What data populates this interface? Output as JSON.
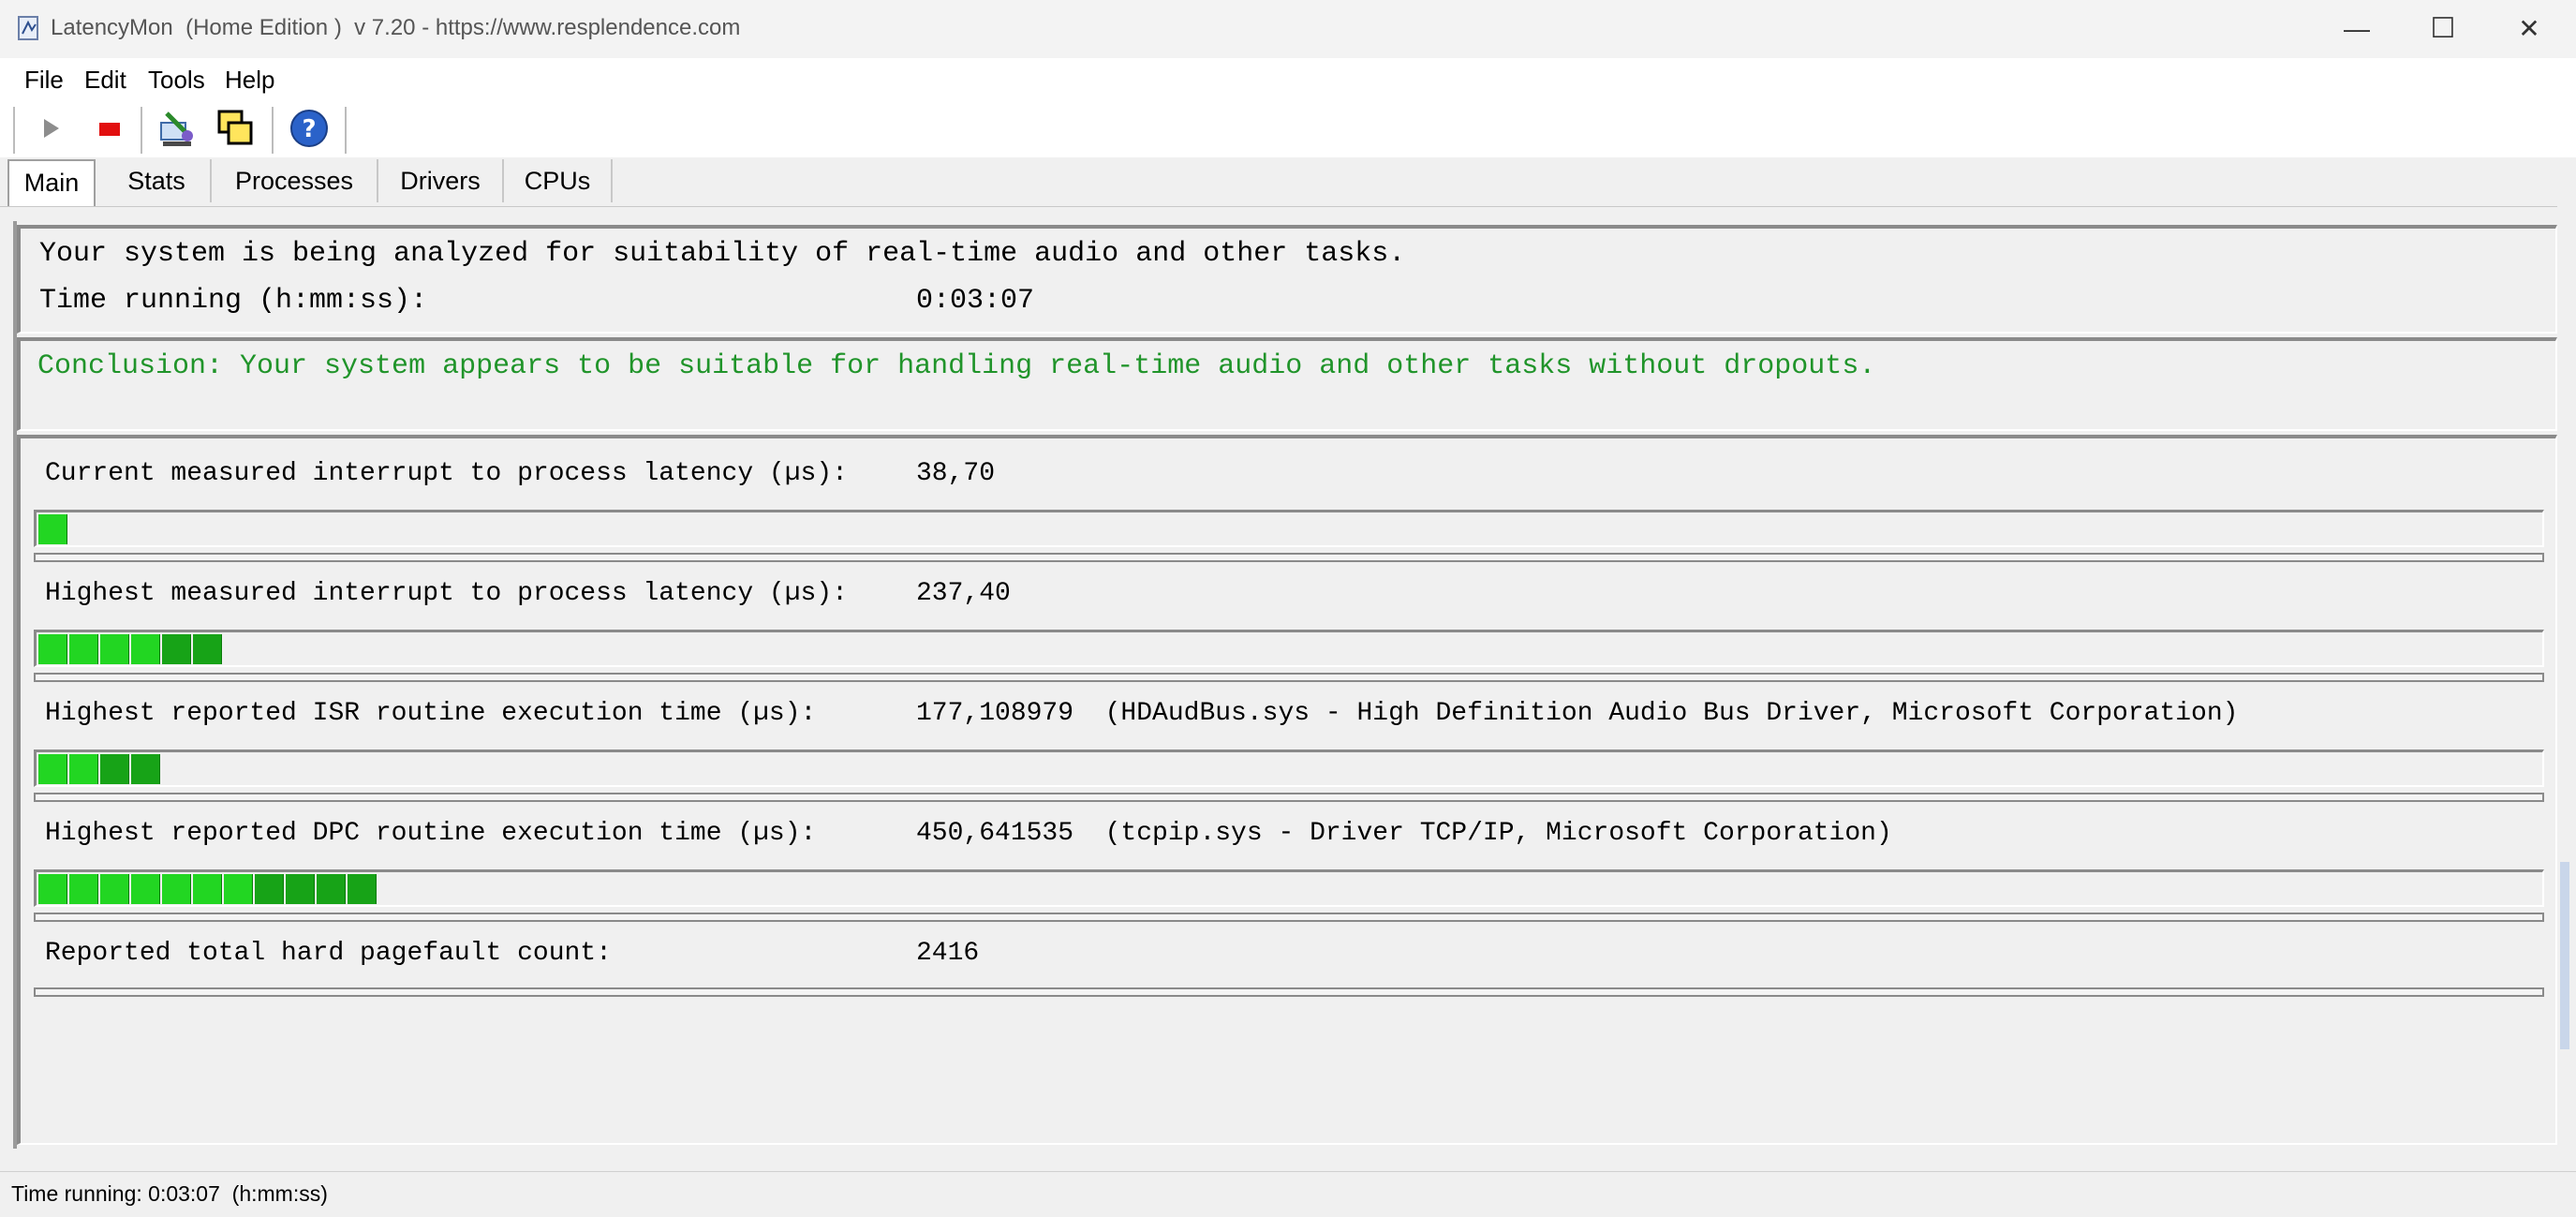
{
  "window": {
    "title": "LatencyMon  (Home Edition )  v 7.20 - https://www.resplendence.com",
    "minimize": "—",
    "maximize": "☐",
    "close": "✕"
  },
  "menu": [
    {
      "label": "File"
    },
    {
      "label": "Edit"
    },
    {
      "label": "Tools"
    },
    {
      "label": "Help"
    }
  ],
  "toolbar": {
    "icons": [
      "play-icon",
      "stop-icon",
      "settings-icon",
      "windows-icon",
      "help-icon"
    ]
  },
  "tabs": [
    {
      "label": "Main",
      "active": true
    },
    {
      "label": "Stats"
    },
    {
      "label": "Processes"
    },
    {
      "label": "Drivers"
    },
    {
      "label": "CPUs"
    }
  ],
  "main": {
    "analysis_text": "Your system is being analyzed for suitability of real-time audio and other tasks.",
    "time_label": "Time running (h:mm:ss):",
    "time_value": "0:03:07",
    "conclusion": "Conclusion: Your system appears to be suitable for handling real-time audio and other tasks without dropouts.",
    "metrics": [
      {
        "label": "Current measured interrupt to process latency (µs):",
        "value": "38,70",
        "segments": 1
      },
      {
        "label": "Highest measured interrupt to process latency (µs):",
        "value": "237,40",
        "segments": 6
      },
      {
        "label": "Highest reported ISR routine execution time (µs):",
        "value": "177,108979  (HDAudBus.sys - High Definition Audio Bus Driver, Microsoft Corporation)",
        "segments": 4
      },
      {
        "label": "Highest reported DPC routine execution time (µs):",
        "value": "450,641535  (tcpip.sys - Driver TCP/IP, Microsoft Corporation)",
        "segments": 11
      },
      {
        "label": "Reported total hard pagefault count:",
        "value": "2416",
        "segments": 0
      }
    ]
  },
  "status": {
    "text": "Time running: 0:03:07  (h:mm:ss)"
  },
  "colors": {
    "conclusion": "#20942a",
    "bar_green": "#22d622",
    "bar_dark_green": "#17a317"
  }
}
